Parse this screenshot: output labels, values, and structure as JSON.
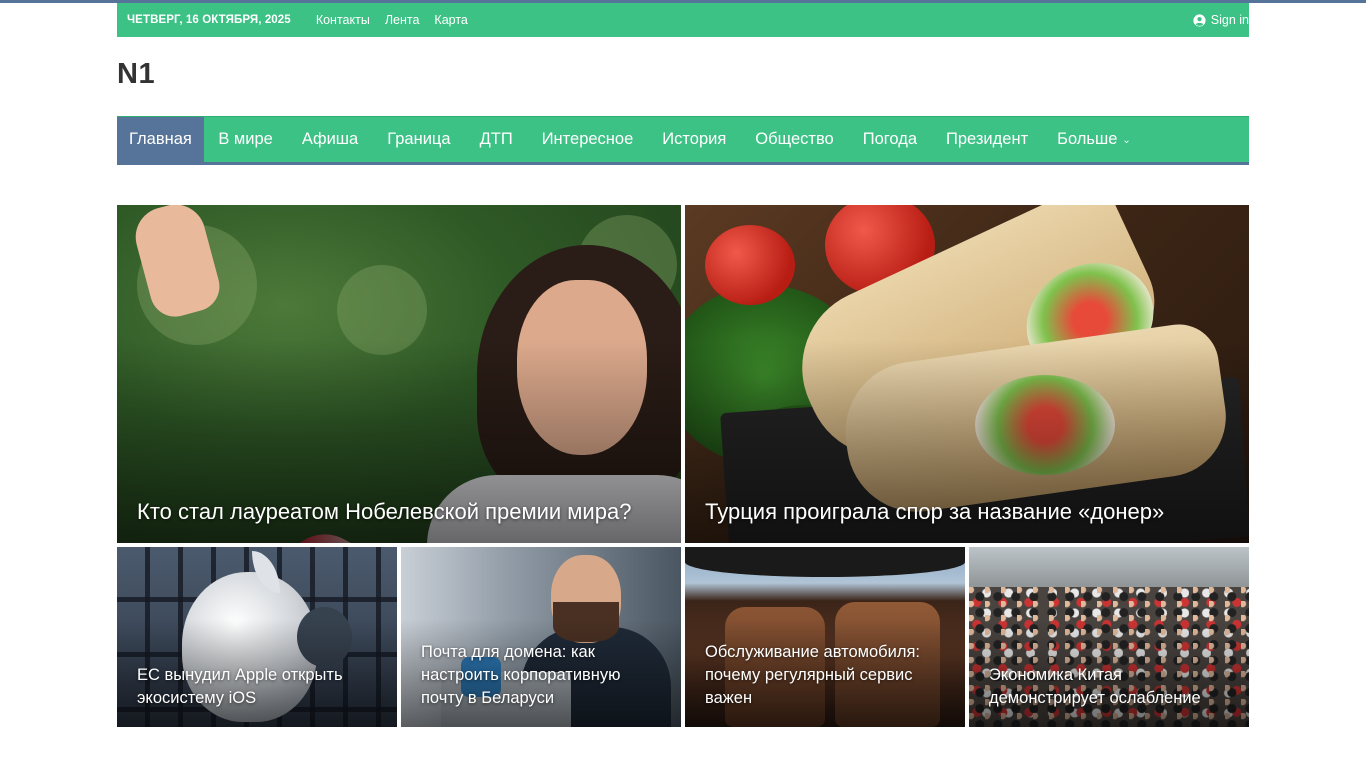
{
  "topbar": {
    "date": "ЧЕТВЕРГ, 16 ОКТЯБРЯ, 2025",
    "links": [
      "Контакты",
      "Лента",
      "Карта"
    ],
    "signin": "Sign in"
  },
  "logo": "N1",
  "nav": {
    "items": [
      "Главная",
      "В мире",
      "Афиша",
      "Граница",
      "ДТП",
      "Интересное",
      "История",
      "Общество",
      "Погода",
      "Президент"
    ],
    "more": "Больше",
    "active_index": 0
  },
  "featured": [
    {
      "title": "Кто стал лауреатом Нобелевской премии мира?"
    },
    {
      "title": "Турция проиграла спор за название «донер»"
    }
  ],
  "small": [
    {
      "title": "ЕС вынудил Apple открыть экосистему iOS"
    },
    {
      "title": "Почта для домена: как настроить корпоративную почту в Беларуси"
    },
    {
      "title": "Обслуживание автомобиля: почему регулярный сервис важен"
    },
    {
      "title": "Экономика Китая демонстрирует ослабление"
    }
  ],
  "colors": {
    "accent": "#3dc286",
    "nav_active": "#56749a"
  }
}
